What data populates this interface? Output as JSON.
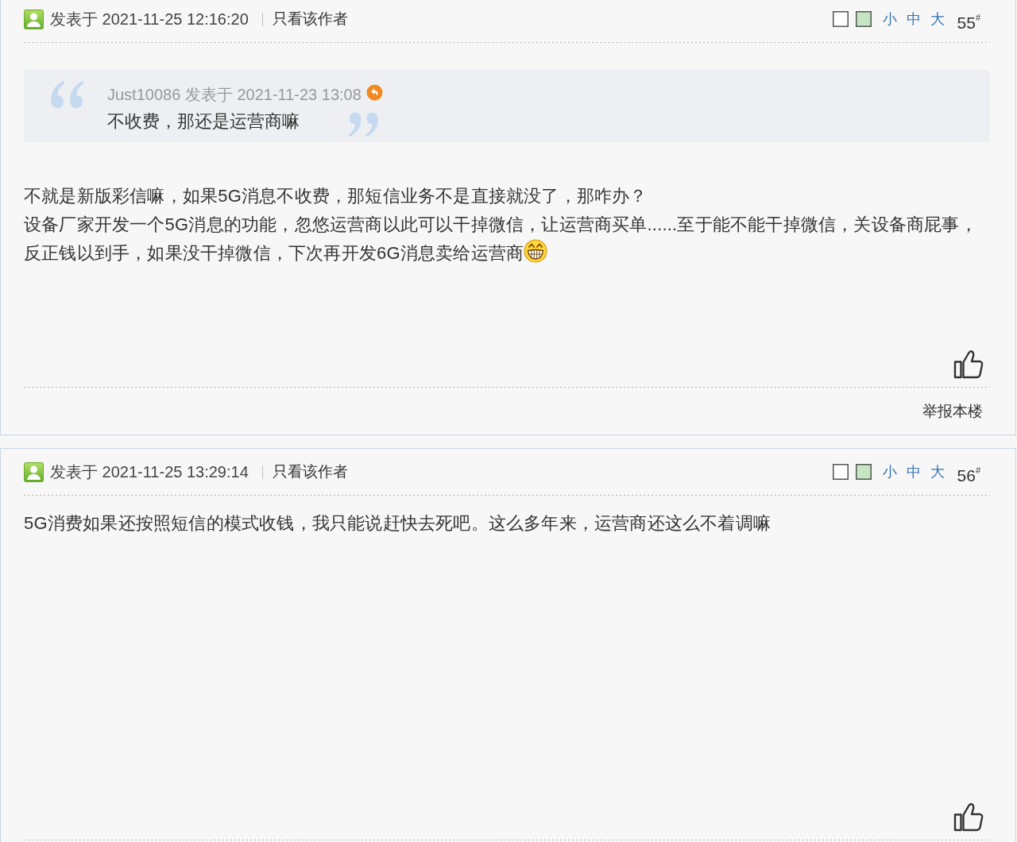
{
  "posts": [
    {
      "posted": "发表于 2021-11-25 12:16:20",
      "author_only": "只看该作者",
      "swatches": [
        {
          "color": "#ffffff"
        },
        {
          "color": "#c6e6c3"
        }
      ],
      "font_sizes": [
        "小",
        "中",
        "大"
      ],
      "floor": "55$^{#}$",
      "quote": {
        "author_line": "Just10086 发表于 2021-11-23 13:08",
        "text": "不收费，那还是运营商嘛"
      },
      "lines": [
        {
          "text": "不就是新版彩信嘛，如果5G消息不收费，那短信业务不是直接就没了，那咋办？",
          "emoji": false
        },
        {
          "text": "设备厂家开发一个5G消息的功能，忽悠运营商以此可以干掉微信，让运营商买单......至于能不能干掉微信，关设备商屁事，",
          "emoji": false
        },
        {
          "text": "反正钱以到手，如果没干掉微信，下次再开发6G消息卖给运营商",
          "emoji": true
        }
      ],
      "report": "举报本楼"
    },
    {
      "posted": "发表于 2021-11-25 13:29:14",
      "author_only": "只看该作者",
      "swatches": [
        {
          "color": "#ffffff"
        },
        {
          "color": "#c6e6c3"
        }
      ],
      "font_sizes": [
        "小",
        "中",
        "大"
      ],
      "floor": "56$^{#}$",
      "lines": [
        {
          "text": "5G消费如果还按照短信的模式收钱，我只能说赶快去死吧。这么多年来，运营商还这么不着调嘛",
          "emoji": false
        }
      ]
    }
  ]
}
